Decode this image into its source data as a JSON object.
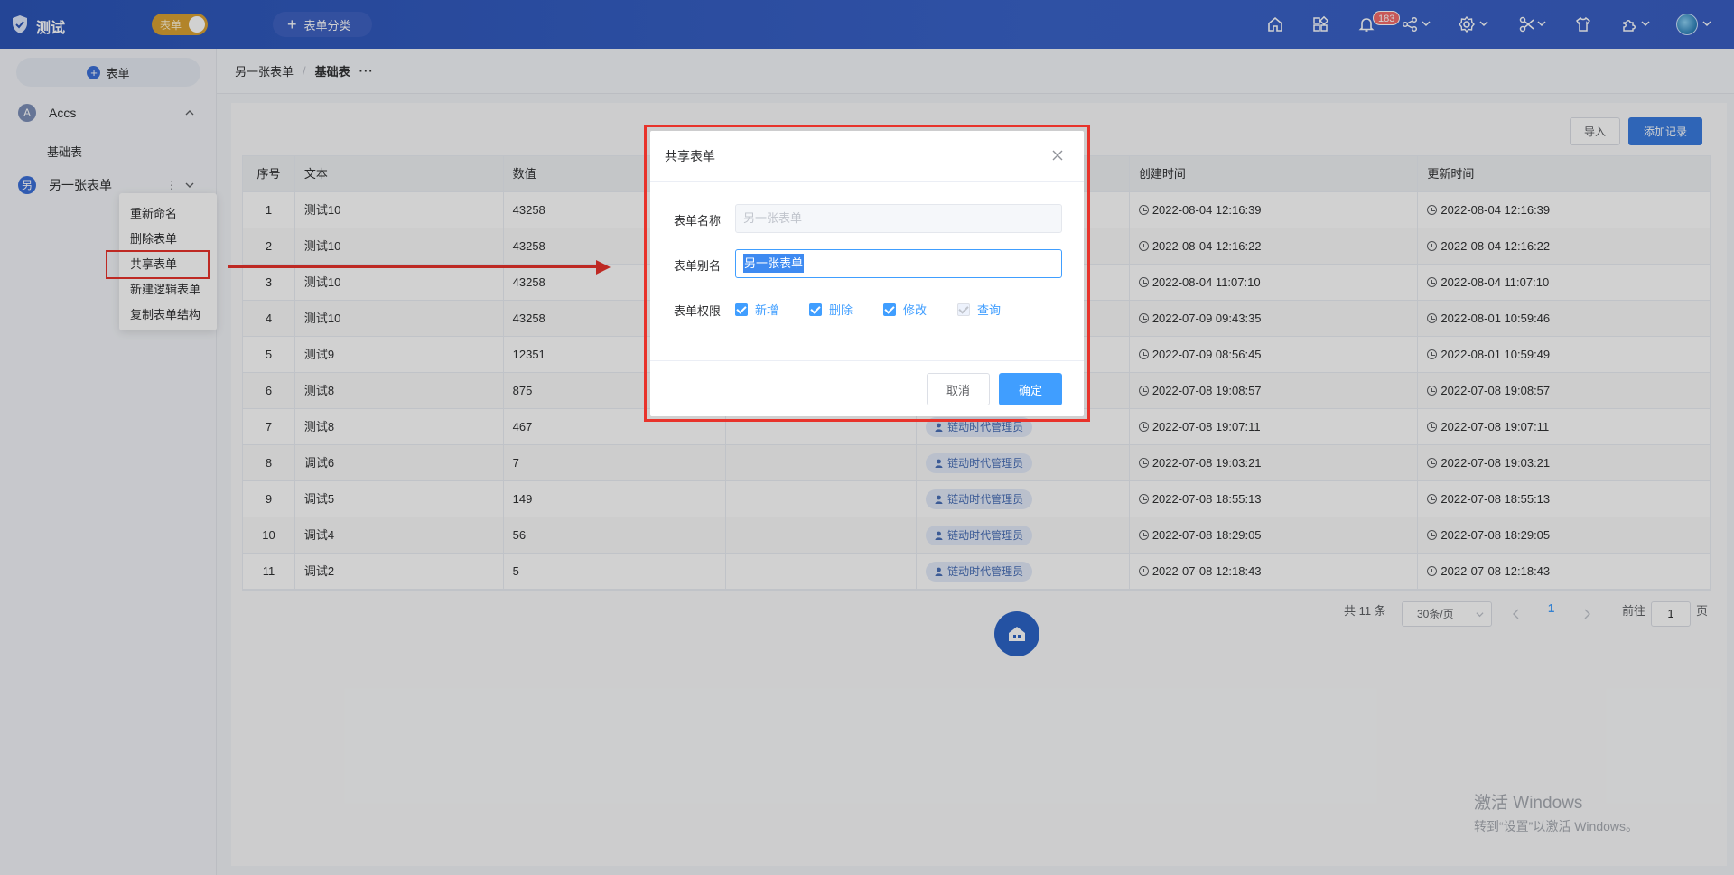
{
  "header": {
    "app_name": "测试",
    "mode_toggle_label": "表单",
    "category_button_label": "表单分类",
    "notification_count": "183",
    "colors": {
      "bar": "#2c55b8",
      "accent": "#409eff",
      "danger": "#f56c6c"
    }
  },
  "sidebar": {
    "add_button_label": "表单",
    "groups": [
      {
        "initial": "A",
        "name": "Accs",
        "color": "#7d8fb8",
        "expanded": true,
        "children": [
          "基础表"
        ]
      },
      {
        "initial": "另",
        "name": "另一张表单",
        "color": "#3b6fd8",
        "expanded": false,
        "children": []
      }
    ],
    "context_menu": [
      "重新命名",
      "删除表单",
      "共享表单",
      "新建逻辑表单",
      "复制表单结构"
    ],
    "highlighted_menu_item": "共享表单"
  },
  "breadcrumb": {
    "parent": "另一张表单",
    "separator": "/",
    "current": "基础表",
    "more": "···"
  },
  "toolbar": {
    "import_label": "导入",
    "add_record_label": "添加记录"
  },
  "table": {
    "columns": [
      "序号",
      "文本",
      "数值",
      "",
      "",
      "创建时间",
      "更新时间"
    ],
    "rows": [
      {
        "no": "1",
        "text": "测试10",
        "num": "43258",
        "creator": "",
        "created": "2022-08-04 12:16:39",
        "updated": "2022-08-04 12:16:39"
      },
      {
        "no": "2",
        "text": "测试10",
        "num": "43258",
        "creator": "",
        "created": "2022-08-04 12:16:22",
        "updated": "2022-08-04 12:16:22"
      },
      {
        "no": "3",
        "text": "测试10",
        "num": "43258",
        "creator": "",
        "created": "2022-08-04 11:07:10",
        "updated": "2022-08-04 11:07:10"
      },
      {
        "no": "4",
        "text": "测试10",
        "num": "43258",
        "creator": "",
        "created": "2022-07-09 09:43:35",
        "updated": "2022-08-01 10:59:46"
      },
      {
        "no": "5",
        "text": "测试9",
        "num": "12351",
        "creator": "",
        "created": "2022-07-09 08:56:45",
        "updated": "2022-08-01 10:59:49"
      },
      {
        "no": "6",
        "text": "测试8",
        "num": "875",
        "creator": "",
        "created": "2022-07-08 19:08:57",
        "updated": "2022-07-08 19:08:57"
      },
      {
        "no": "7",
        "text": "测试8",
        "num": "467",
        "creator": "链动时代管理员",
        "created": "2022-07-08 19:07:11",
        "updated": "2022-07-08 19:07:11"
      },
      {
        "no": "8",
        "text": "调试6",
        "num": "7",
        "creator": "链动时代管理员",
        "created": "2022-07-08 19:03:21",
        "updated": "2022-07-08 19:03:21"
      },
      {
        "no": "9",
        "text": "调试5",
        "num": "149",
        "creator": "链动时代管理员",
        "created": "2022-07-08 18:55:13",
        "updated": "2022-07-08 18:55:13"
      },
      {
        "no": "10",
        "text": "调试4",
        "num": "56",
        "creator": "链动时代管理员",
        "created": "2022-07-08 18:29:05",
        "updated": "2022-07-08 18:29:05"
      },
      {
        "no": "11",
        "text": "调试2",
        "num": "5",
        "creator": "链动时代管理员",
        "created": "2022-07-08 12:18:43",
        "updated": "2022-07-08 12:18:43"
      }
    ]
  },
  "pagination": {
    "total": "共 11 条",
    "page_size": "30条/页",
    "current_page": "1",
    "goto_prefix": "前往",
    "goto_value": "1",
    "goto_suffix": "页"
  },
  "modal": {
    "title": "共享表单",
    "name_label": "表单名称",
    "name_placeholder": "另一张表单",
    "alias_label": "表单别名",
    "alias_value": "另一张表单",
    "permission_label": "表单权限",
    "permissions": [
      {
        "label": "新增",
        "checked": true,
        "disabled": false
      },
      {
        "label": "删除",
        "checked": true,
        "disabled": false
      },
      {
        "label": "修改",
        "checked": true,
        "disabled": false
      },
      {
        "label": "查询",
        "checked": true,
        "disabled": true
      }
    ],
    "cancel_label": "取消",
    "confirm_label": "确定"
  },
  "watermark": {
    "line1": "激活 Windows",
    "line2": "转到“设置”以激活 Windows。"
  }
}
